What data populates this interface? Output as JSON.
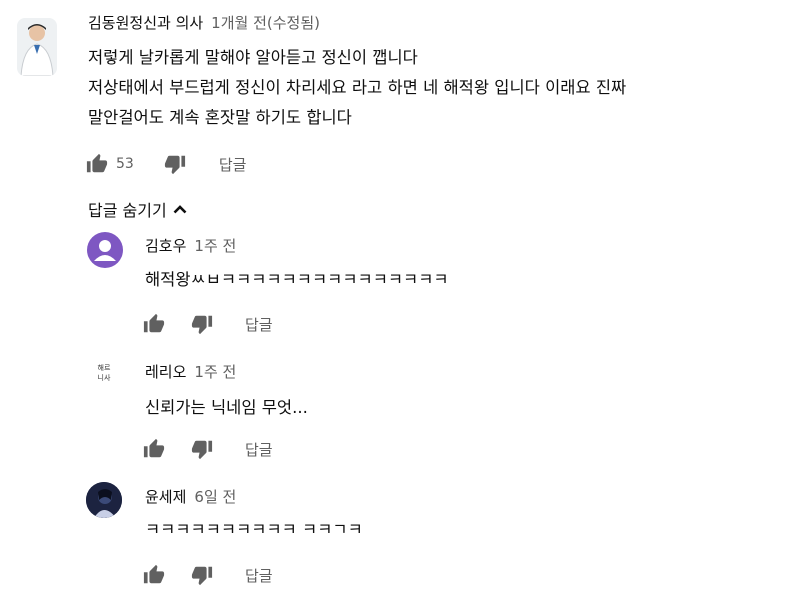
{
  "main_comment": {
    "author": "김동원정신과 의사",
    "time": "1개월 전(수정됨)",
    "lines": [
      "저렇게 날카롭게 말해야 알아듣고 정신이 깹니다",
      "저상태에서 부드럽게 정신이 차리세요 라고 하면 네 해적왕 입니다 이래요 진짜",
      "말안걸어도 계속 혼잣말 하기도 합니다"
    ],
    "like_count": "53",
    "reply_label": "답글"
  },
  "hide_replies_label": "답글 숨기기",
  "replies": [
    {
      "author": "김호우",
      "time": "1주 전",
      "text": "해적왕ㅆㅂㅋㅋㅋㅋㅋㅋㅋㅋㅋㅋㅋㅋㅋㅋㅋ",
      "reply_label": "답글",
      "avatar_color": "#7e57c2"
    },
    {
      "author": "레리오",
      "time": "1주 전",
      "text": "신뢰가는 닉네임 무엇...",
      "reply_label": "답글",
      "avatar_text": "해르\n니사"
    },
    {
      "author": "윤세제",
      "time": "6일 전",
      "text": "ㅋㅋㅋㅋㅋㅋㅋㅋㅋㅋ ㅋㅋㄱㅋ",
      "reply_label": "답글"
    }
  ],
  "icons": {
    "like": "thumb-up-icon",
    "dislike": "thumb-down-icon",
    "chevron": "chevron-up-icon"
  },
  "colors": {
    "text": "#0f0f0f",
    "secondary": "#606060",
    "icon": "#606060",
    "default_avatar": "#7e57c2"
  }
}
